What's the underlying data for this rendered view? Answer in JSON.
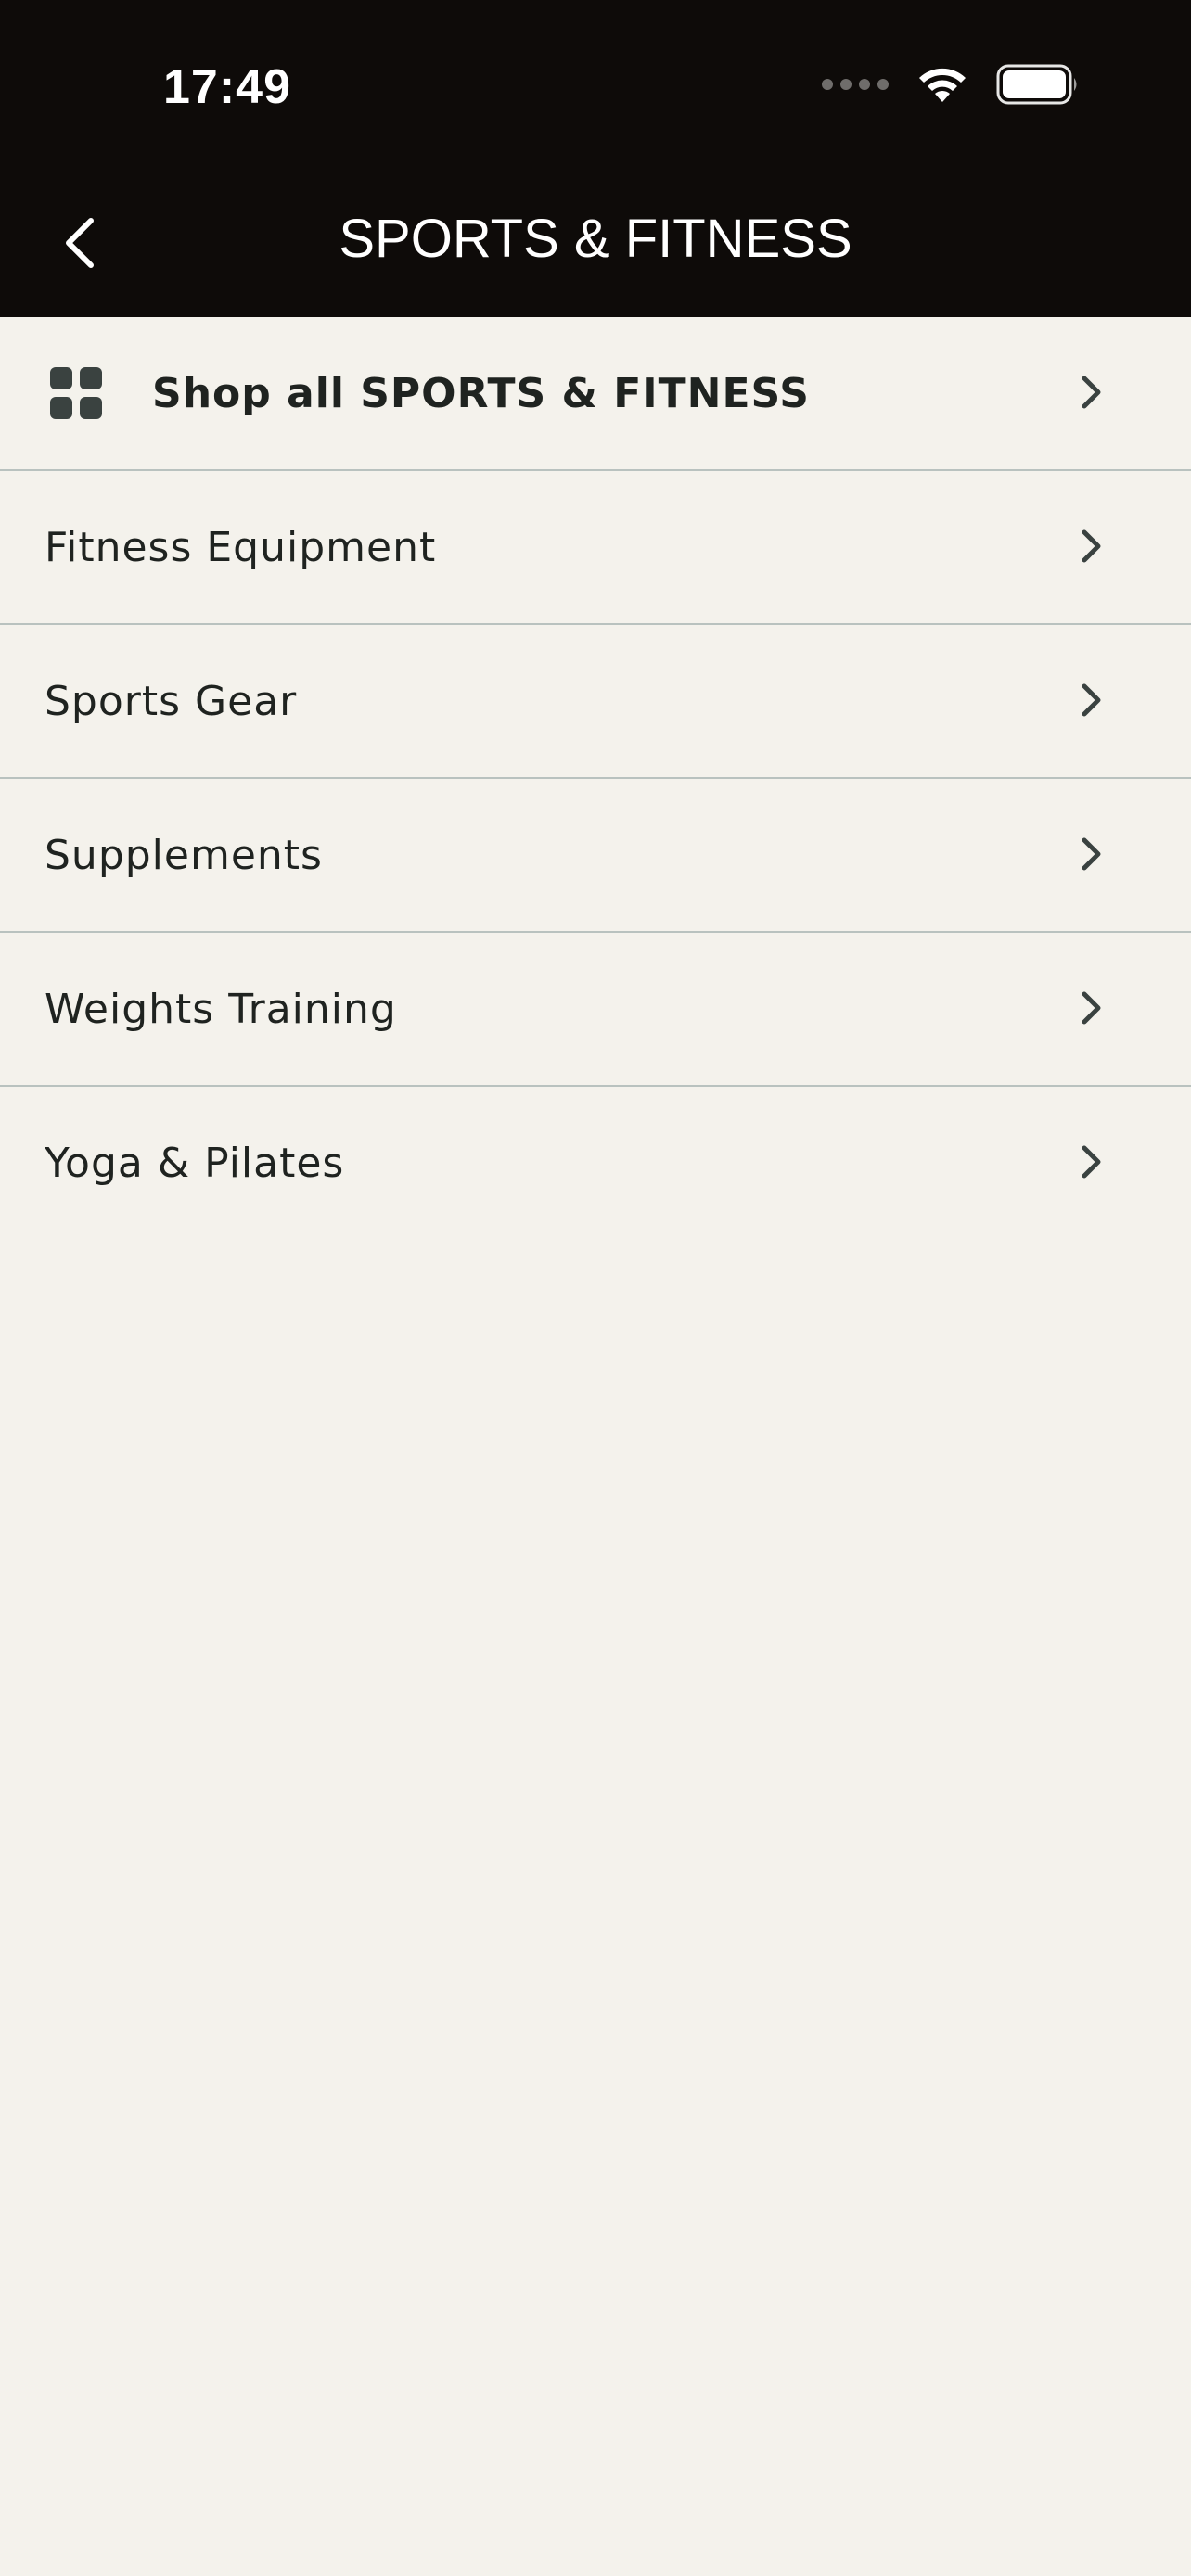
{
  "status_bar": {
    "time": "17:49",
    "icons": [
      "signal-dots-icon",
      "wifi-icon",
      "battery-icon"
    ]
  },
  "header": {
    "title": "SPORTS & FITNESS",
    "back_icon": "chevron-left-icon"
  },
  "colors": {
    "header_bg": "#0e0b09",
    "page_bg": "#f4f2ec",
    "divider": "#b9c2bf",
    "text": "#1f2320",
    "icon": "#3a4240"
  },
  "menu": {
    "shop_all": {
      "label": "Shop all SPORTS & FITNESS",
      "icon": "grid-icon"
    },
    "items": [
      {
        "label": "Fitness Equipment"
      },
      {
        "label": "Sports Gear"
      },
      {
        "label": "Supplements"
      },
      {
        "label": "Weights Training"
      },
      {
        "label": "Yoga & Pilates"
      }
    ]
  }
}
